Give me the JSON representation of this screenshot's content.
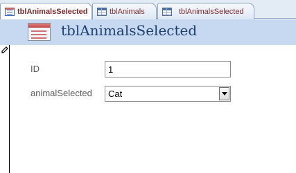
{
  "tabs": [
    {
      "label": "tblAnimalsSelected",
      "type": "form",
      "active": true
    },
    {
      "label": "tblAnimals",
      "type": "table",
      "active": false
    },
    {
      "label": "tblAnimalsSelected",
      "type": "table",
      "active": false
    }
  ],
  "form": {
    "title": "tblAnimalsSelected",
    "fields": [
      {
        "label": "ID",
        "value": "1",
        "control": "textbox"
      },
      {
        "label": "animalSelected",
        "value": "Cat",
        "control": "combobox"
      }
    ]
  },
  "colors": {
    "header_background": "#c6d9f0",
    "title_text": "#1f3f6f",
    "label_text": "#5a5a5a",
    "tab_text": "#7a2a2a"
  }
}
